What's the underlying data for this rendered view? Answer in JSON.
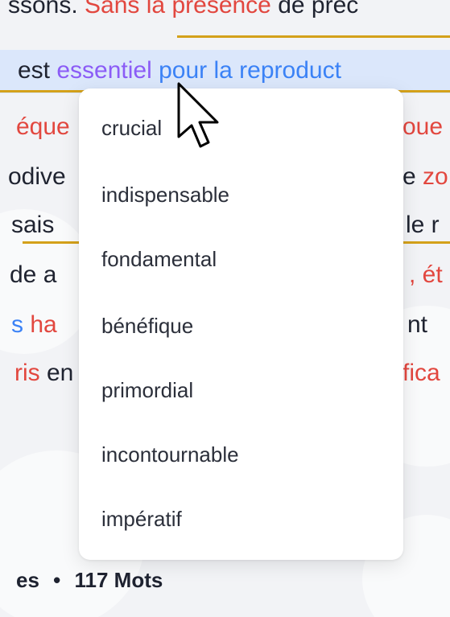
{
  "lines": {
    "l1": {
      "a": "ssons. ",
      "b": "Sans la ",
      "c": "présence",
      "d": " de préc"
    },
    "l2": {
      "a": " est ",
      "b": "essentiel",
      "c": " pour la reproduct"
    },
    "l3": {
      "left": "éque",
      "right": "oue"
    },
    "l4": {
      "left": "odive",
      "right1": "e ",
      "right2": "zo"
    },
    "l5": {
      "left": " sais",
      "right": "le r"
    },
    "l6": {
      "left": "de a",
      "right1": ", ét"
    },
    "l7": {
      "left1": "s ",
      "left2": "ha",
      "right": "nt"
    },
    "l8": {
      "left1": "ris",
      "left2": " en",
      "right": "fica"
    }
  },
  "suggestions": [
    "crucial",
    "indispensable",
    "fondamental",
    "bénéfique",
    "primordial",
    "incontournable",
    "impératif"
  ],
  "footer": {
    "prefix": "es",
    "bullet": "•",
    "word_count": "117 Mots"
  }
}
